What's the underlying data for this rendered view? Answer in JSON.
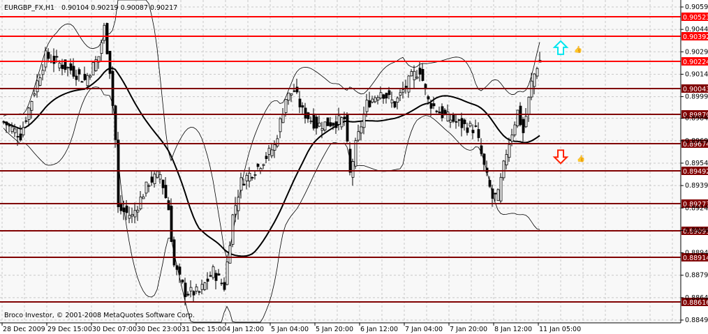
{
  "header": {
    "symbol": "EURGBP_FX,H1",
    "ohlc": "0.90104 0.90219 0.90087 0.90217"
  },
  "copyright": "Broco Investor, © 2001-2008 MetaQuotes Software Corp.",
  "colors": {
    "bg": "#f8f8f8",
    "grid": "#c8c8c8",
    "level_bright": "#ff0000",
    "level_dark": "#800000",
    "candle": "#000000",
    "up_arrow": "#00e5ee",
    "down_arrow": "#ff2000",
    "thumb": "#00e5ee"
  },
  "chart_data": {
    "type": "candlestick",
    "title": "EURGBP_FX,H1",
    "ylim": [
      0.88495,
      0.9059
    ],
    "y_ticks": [
      "0.90590",
      "0.90440",
      "0.90290",
      "0.90140",
      "0.89990",
      "0.89845",
      "0.89695",
      "0.89545",
      "0.89395",
      "0.89245",
      "0.89095",
      "0.88945",
      "0.88795",
      "0.88645",
      "0.88495"
    ],
    "x_ticks": [
      "28 Dec 2009",
      "29 Dec 15:00",
      "30 Dec 07:00",
      "30 Dec 23:00",
      "31 Dec 15:00",
      "4 Jan 12:00",
      "5 Jan 04:00",
      "5 Jan 20:00",
      "6 Jan 12:00",
      "7 Jan 04:00",
      "7 Jan 20:00",
      "8 Jan 12:00",
      "11 Jan 05:00"
    ],
    "bars_per_tick": 16,
    "close_points": [
      [
        0,
        0.8982
      ],
      [
        6,
        0.8973
      ],
      [
        11,
        0.9003
      ],
      [
        15,
        0.9026
      ],
      [
        19,
        0.9022
      ],
      [
        24,
        0.9017
      ],
      [
        29,
        0.901
      ],
      [
        34,
        0.9026
      ],
      [
        36,
        0.9045
      ],
      [
        38,
        0.9017
      ],
      [
        40,
        0.897
      ],
      [
        41,
        0.8924
      ],
      [
        46,
        0.8919
      ],
      [
        52,
        0.8942
      ],
      [
        56,
        0.8947
      ],
      [
        59,
        0.8924
      ],
      [
        61,
        0.8886
      ],
      [
        65,
        0.8868
      ],
      [
        70,
        0.8868
      ],
      [
        75,
        0.8882
      ],
      [
        79,
        0.8872
      ],
      [
        82,
        0.8919
      ],
      [
        85,
        0.8942
      ],
      [
        91,
        0.8952
      ],
      [
        97,
        0.8966
      ],
      [
        101,
        0.8998
      ],
      [
        104,
        0.9003
      ],
      [
        107,
        0.8989
      ],
      [
        112,
        0.898
      ],
      [
        119,
        0.8982
      ],
      [
        122,
        0.8984
      ],
      [
        124,
        0.8947
      ],
      [
        126,
        0.8966
      ],
      [
        130,
        0.8994
      ],
      [
        135,
        0.9003
      ],
      [
        140,
        0.8994
      ],
      [
        146,
        0.9012
      ],
      [
        149,
        0.9017
      ],
      [
        152,
        0.8996
      ],
      [
        157,
        0.8987
      ],
      [
        164,
        0.898
      ],
      [
        169,
        0.8977
      ],
      [
        172,
        0.8952
      ],
      [
        175,
        0.8931
      ],
      [
        177,
        0.8933
      ],
      [
        180,
        0.8962
      ],
      [
        184,
        0.8989
      ],
      [
        186,
        0.8975
      ],
      [
        189,
        0.9008
      ],
      [
        191,
        0.902
      ],
      [
        192,
        0.9022
      ]
    ],
    "levels": [
      {
        "price": "0.90523",
        "style": "bright"
      },
      {
        "price": "0.90392",
        "style": "bright"
      },
      {
        "price": "0.90224",
        "style": "bright"
      },
      {
        "price": "0.90043",
        "style": "dark"
      },
      {
        "price": "0.89870",
        "style": "dark"
      },
      {
        "price": "0.89674",
        "style": "dark"
      },
      {
        "price": "0.89492",
        "style": "dark"
      },
      {
        "price": "0.89273",
        "style": "dark"
      },
      {
        "price": "0.89091",
        "style": "dark"
      },
      {
        "price": "0.88914",
        "style": "dark"
      },
      {
        "price": "0.88616",
        "style": "dark"
      }
    ],
    "signals": [
      {
        "type": "up-arrow",
        "price": 0.9032
      },
      {
        "type": "down-arrow",
        "price": 0.8959
      }
    ]
  }
}
